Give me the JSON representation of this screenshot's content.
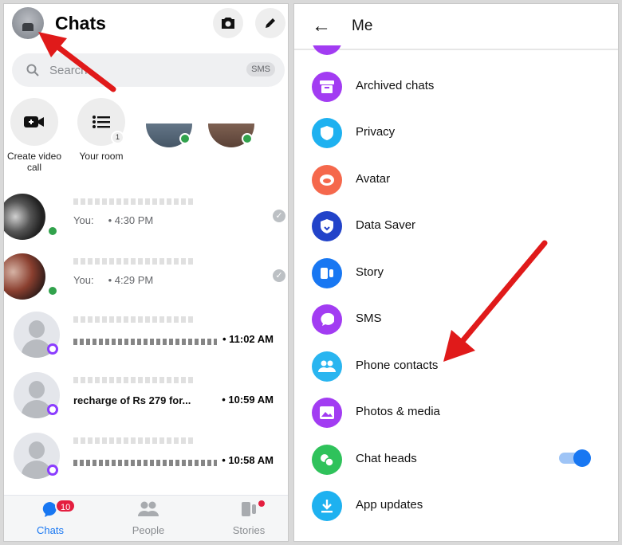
{
  "left": {
    "title": "Chats",
    "search_placeholder": "Search",
    "search_badge": "SMS",
    "stories": [
      {
        "label": "Create video call"
      },
      {
        "label": "Your room",
        "badge": "1"
      }
    ],
    "chats": [
      {
        "prefix": "You:",
        "time": "4:30 PM",
        "status": "seen"
      },
      {
        "prefix": "You:",
        "time": "4:29 PM",
        "status": "seen"
      },
      {
        "time": "• 11:02 AM"
      },
      {
        "preview": "recharge of Rs 279 for...",
        "time": "• 10:59 AM"
      },
      {
        "time": "• 10:58 AM"
      }
    ],
    "tabs": [
      {
        "label": "Chats",
        "badge": "10",
        "active": true
      },
      {
        "label": "People"
      },
      {
        "label": "Stories"
      }
    ]
  },
  "right": {
    "title": "Me",
    "items": [
      {
        "label": "Archived chats",
        "icon": "archive-icon",
        "color": "#a23cf2"
      },
      {
        "label": "Privacy",
        "icon": "shield-icon",
        "color": "#1eb1f0"
      },
      {
        "label": "Avatar",
        "icon": "avatar-icon",
        "color": "#f5684c"
      },
      {
        "label": "Data Saver",
        "icon": "data-saver-icon",
        "color": "#2243c9"
      },
      {
        "label": "Story",
        "icon": "story-icon",
        "color": "#1877f2"
      },
      {
        "label": "SMS",
        "icon": "sms-icon",
        "color": "#a23cf2"
      },
      {
        "label": "Phone contacts",
        "icon": "contacts-icon",
        "color": "#29b5f0"
      },
      {
        "label": "Photos & media",
        "icon": "photo-icon",
        "color": "#a23cf2"
      },
      {
        "label": "Chat heads",
        "icon": "chat-heads-icon",
        "color": "#2fc25b",
        "toggle": true
      },
      {
        "label": "App updates",
        "icon": "download-icon",
        "color": "#1eb1f0"
      }
    ]
  },
  "colors": {
    "accent": "#1877f2",
    "arrow": "#e01a1a"
  }
}
